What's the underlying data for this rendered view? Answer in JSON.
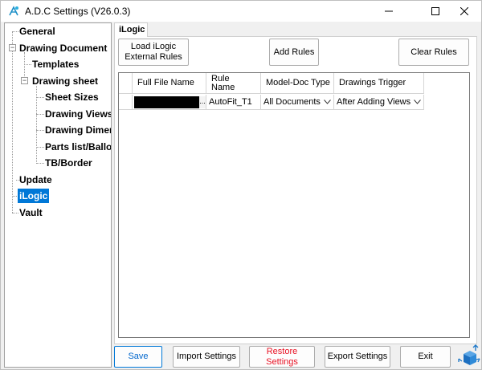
{
  "window": {
    "title": "A.D.C Settings (V26.0.3)",
    "icons": {
      "app": "app-logo-icon",
      "minimize": "minimize-icon",
      "maximize": "maximize-icon",
      "close": "close-icon"
    }
  },
  "tree": {
    "items": [
      {
        "label": "General"
      },
      {
        "label": "Drawing Document"
      },
      {
        "label": "Templates"
      },
      {
        "label": "Drawing sheet"
      },
      {
        "label": "Sheet Sizes"
      },
      {
        "label": "Drawing Views"
      },
      {
        "label": "Drawing Dimen"
      },
      {
        "label": "Parts list/Balloo"
      },
      {
        "label": "TB/Border"
      },
      {
        "label": "Update"
      },
      {
        "label": "iLogic"
      },
      {
        "label": "Vault"
      }
    ],
    "selected": "iLogic",
    "expander_symbol": "−"
  },
  "tab": {
    "label": "iLogic"
  },
  "buttons": {
    "load_line1": "Load iLogic",
    "load_line2": "External Rules",
    "add_rules": "Add Rules",
    "clear_rules": "Clear Rules"
  },
  "grid": {
    "columns": [
      "Full File Name",
      "Rule Name",
      "Model-Doc Type",
      "Drawings Trigger"
    ],
    "rows": [
      {
        "file": "",
        "browse": "...",
        "rule": "AutoFit_T1",
        "doc_type": "All Documents",
        "trigger": "After Adding Views"
      }
    ]
  },
  "footer": {
    "save": "Save",
    "import": "Import Settings",
    "restore": "Restore Settings",
    "export": "Export Settings",
    "exit": "Exit",
    "colors": {
      "restore_text": "#e81123",
      "save_text": "#0066cc",
      "accent": "#0078d7"
    }
  }
}
